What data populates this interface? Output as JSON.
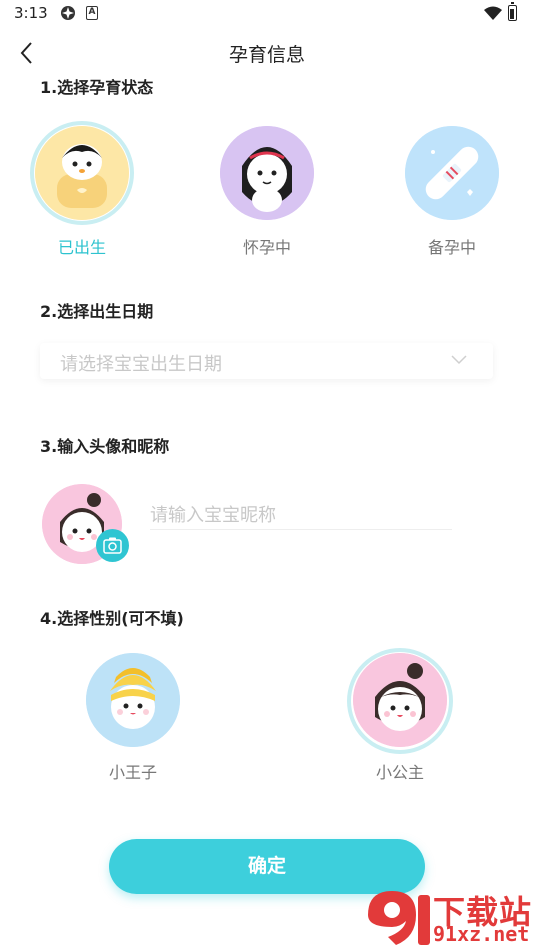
{
  "status_bar": {
    "time": "3:13",
    "notif_letter": "A"
  },
  "nav": {
    "title": "孕育信息"
  },
  "section1": {
    "title": "1.选择孕育状态",
    "options": [
      {
        "label": "已出生",
        "selected": true
      },
      {
        "label": "怀孕中",
        "selected": false
      },
      {
        "label": "备孕中",
        "selected": false
      }
    ]
  },
  "section2": {
    "title": "2.选择出生日期",
    "placeholder": "请选择宝宝出生日期"
  },
  "section3": {
    "title": "3.输入头像和昵称",
    "nickname_placeholder": "请输入宝宝昵称"
  },
  "section4": {
    "title": "4.选择性别(可不填)",
    "options": [
      {
        "label": "小王子",
        "selected": false
      },
      {
        "label": "小公主",
        "selected": true
      }
    ]
  },
  "confirm_label": "确定",
  "watermark": {
    "text": "下载站",
    "url": "91xz.net"
  },
  "colors": {
    "accent": "#3dcfdc",
    "label": "#777777",
    "placeholder": "#c8c8c8"
  }
}
